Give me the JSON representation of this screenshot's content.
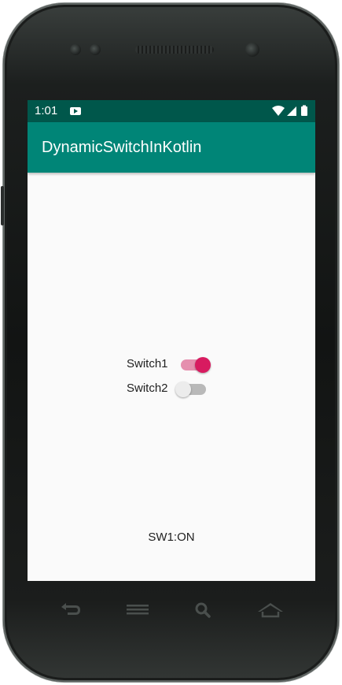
{
  "status_bar": {
    "time": "1:01",
    "icons": [
      "youtube-icon",
      "wifi-icon",
      "signal-icon",
      "battery-icon"
    ]
  },
  "app_bar": {
    "title": "DynamicSwitchInKotlin",
    "color": "#008577",
    "status_color": "#00574b"
  },
  "switches": [
    {
      "label": "Switch1",
      "checked": true,
      "accent": "#d81b60"
    },
    {
      "label": "Switch2",
      "checked": false
    }
  ],
  "result": {
    "text": "SW1:ON"
  },
  "nav_keys": [
    "back-icon",
    "menu-icon",
    "search-icon",
    "home-icon"
  ]
}
